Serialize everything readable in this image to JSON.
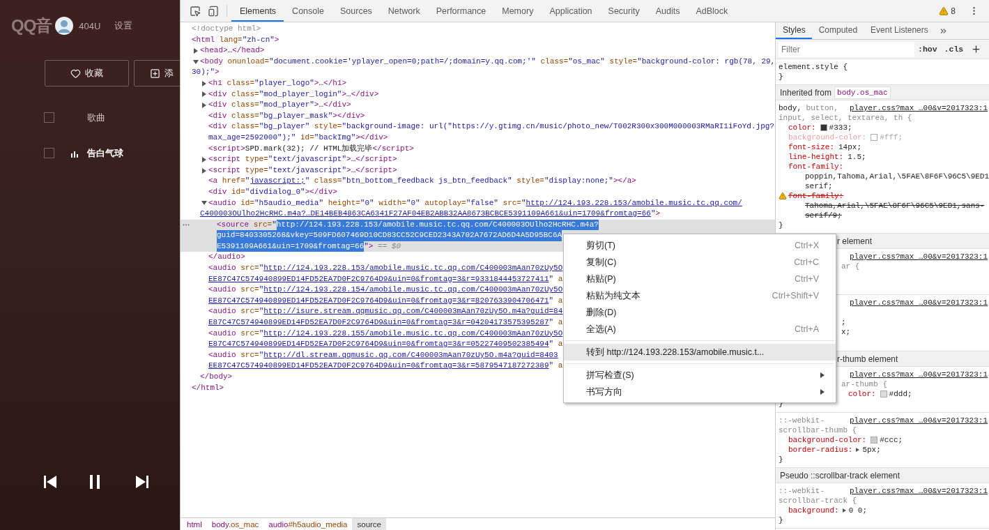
{
  "player": {
    "logo": "QQ音",
    "user": "404U",
    "settings": "设置",
    "buttons": [
      {
        "kind": "favorite",
        "label": "收藏"
      },
      {
        "kind": "add",
        "label": "添"
      }
    ],
    "songs": [
      {
        "title": "歌曲",
        "checked": false,
        "playing": false
      },
      {
        "title": "告白气球",
        "checked": false,
        "playing": true
      }
    ]
  },
  "devtools": {
    "tabs": [
      {
        "label": "Elements",
        "selected": true
      },
      {
        "label": "Console",
        "selected": false
      },
      {
        "label": "Sources",
        "selected": false
      },
      {
        "label": "Network",
        "selected": false
      },
      {
        "label": "Performance",
        "selected": false
      },
      {
        "label": "Memory",
        "selected": false
      },
      {
        "label": "Application",
        "selected": false
      },
      {
        "label": "Security",
        "selected": false
      },
      {
        "label": "Audits",
        "selected": false
      },
      {
        "label": "AdBlock",
        "selected": false
      }
    ],
    "warnings": "8",
    "tree": [
      {
        "kind": "plain",
        "selected": false,
        "lines": [
          [
            {
              "doctype": "<!doctype html>"
            }
          ]
        ]
      },
      {
        "kind": "plain",
        "selected": false,
        "lines": [
          [
            {
              "tag": "<html"
            },
            {
              "attr": " lang="
            },
            {
              "value": "\"zh-cn\""
            },
            {
              "tag": ">"
            }
          ]
        ],
        "close": [
          {
            "tag": "</html>"
          }
        ],
        "children": [
          {
            "kind": "expandable",
            "expanded": false,
            "selected": false,
            "lines": [
              [
                {
                  "tag": "<head>"
                },
                {
                  "text": "…"
                },
                {
                  "tag": "</head>"
                }
              ]
            ]
          },
          {
            "kind": "expandable",
            "expanded": true,
            "selected": false,
            "lines": [
              [
                {
                  "tag": "<body"
                },
                {
                  "attr": " onunload="
                },
                {
                  "value": "\"document.cookie='yplayer_open=0;path=/;domain=y.qq.com;'\""
                },
                {
                  "attr": " class="
                },
                {
                  "value": "\"os_mac\""
                },
                {
                  "attr": " style="
                },
                {
                  "value": "\"background-color: rgb(78, 29,"
                }
              ],
              [
                {
                  "value": "30);\""
                },
                {
                  "tag": ">"
                }
              ]
            ],
            "close": [
              {
                "tag": "</body>"
              }
            ],
            "children": [
              {
                "kind": "expandable",
                "expanded": false,
                "selected": false,
                "lines": [
                  [
                    {
                      "tag": "<h1"
                    },
                    {
                      "attr": " class="
                    },
                    {
                      "value": "\"player_logo\""
                    },
                    {
                      "tag": ">"
                    },
                    {
                      "text": "…"
                    },
                    {
                      "tag": "</h1>"
                    }
                  ]
                ]
              },
              {
                "kind": "expandable",
                "expanded": false,
                "selected": false,
                "lines": [
                  [
                    {
                      "tag": "<div"
                    },
                    {
                      "attr": " class="
                    },
                    {
                      "value": "\"mod_player_login\""
                    },
                    {
                      "tag": ">"
                    },
                    {
                      "text": "…"
                    },
                    {
                      "tag": "</div>"
                    }
                  ]
                ]
              },
              {
                "kind": "expandable",
                "expanded": false,
                "selected": false,
                "lines": [
                  [
                    {
                      "tag": "<div"
                    },
                    {
                      "attr": " class="
                    },
                    {
                      "value": "\"mod_player\""
                    },
                    {
                      "tag": ">"
                    },
                    {
                      "text": "…"
                    },
                    {
                      "tag": "</div>"
                    }
                  ]
                ]
              },
              {
                "kind": "plain",
                "selected": false,
                "lines": [
                  [
                    {
                      "tag": "<div"
                    },
                    {
                      "attr": " class="
                    },
                    {
                      "value": "\"bg_player_mask\""
                    },
                    {
                      "tag": "></div>"
                    }
                  ]
                ]
              },
              {
                "kind": "plain",
                "selected": false,
                "lines": [
                  [
                    {
                      "tag": "<div"
                    },
                    {
                      "attr": " class="
                    },
                    {
                      "value": "\"bg_player\""
                    },
                    {
                      "attr": " style="
                    },
                    {
                      "value": "\"background-image: url(\"https://y.gtimg.cn/music/photo_new/T002R300x300M000003RMaRI1iFoYd.jpg?"
                    }
                  ],
                  [
                    {
                      "value": "max_age=2592000\");\""
                    },
                    {
                      "attr": " id="
                    },
                    {
                      "value": "\"backImg\""
                    },
                    {
                      "tag": "></div>"
                    }
                  ]
                ]
              },
              {
                "kind": "plain",
                "selected": false,
                "lines": [
                  [
                    {
                      "tag": "<script>"
                    },
                    {
                      "text": "SPD.mark(32); // HTML加载完毕"
                    },
                    {
                      "tag": "</script>"
                    }
                  ]
                ]
              },
              {
                "kind": "expandable",
                "expanded": false,
                "selected": false,
                "lines": [
                  [
                    {
                      "tag": "<script"
                    },
                    {
                      "attr": " type="
                    },
                    {
                      "value": "\"text/javascript\""
                    },
                    {
                      "tag": ">"
                    },
                    {
                      "text": "…"
                    },
                    {
                      "tag": "</script>"
                    }
                  ]
                ]
              },
              {
                "kind": "expandable",
                "expanded": false,
                "selected": false,
                "lines": [
                  [
                    {
                      "tag": "<script"
                    },
                    {
                      "attr": " type="
                    },
                    {
                      "value": "\"text/javascript\""
                    },
                    {
                      "tag": ">"
                    },
                    {
                      "text": "…"
                    },
                    {
                      "tag": "</script>"
                    }
                  ]
                ]
              },
              {
                "kind": "plain",
                "selected": false,
                "lines": [
                  [
                    {
                      "tag": "<a"
                    },
                    {
                      "attr": " href="
                    },
                    {
                      "value": "\""
                    },
                    {
                      "link": "javascript:;"
                    },
                    {
                      "value": "\""
                    },
                    {
                      "attr": " class="
                    },
                    {
                      "value": "\"btn_bottom_feedback js_btn_feedback\""
                    },
                    {
                      "attr": " style="
                    },
                    {
                      "value": "\"display:none;\""
                    },
                    {
                      "tag": "></a>"
                    }
                  ]
                ]
              },
              {
                "kind": "plain",
                "selected": false,
                "lines": [
                  [
                    {
                      "tag": "<div"
                    },
                    {
                      "attr": " id="
                    },
                    {
                      "value": "\"divdialog_0\""
                    },
                    {
                      "tag": "></div>"
                    }
                  ]
                ]
              },
              {
                "kind": "expandable",
                "expanded": true,
                "selected": false,
                "lines": [
                  [
                    {
                      "tag": "<audio"
                    },
                    {
                      "attr": " id="
                    },
                    {
                      "value": "\"h5audio_media\""
                    },
                    {
                      "attr": " height="
                    },
                    {
                      "value": "\"0\""
                    },
                    {
                      "attr": " width="
                    },
                    {
                      "value": "\"0\""
                    },
                    {
                      "attr": " autoplay="
                    },
                    {
                      "value": "\"false\""
                    },
                    {
                      "attr": " src="
                    },
                    {
                      "value": "\""
                    },
                    {
                      "link": "http://124.193.228.153/amobile.music.tc.qq.com/"
                    }
                  ],
                  [
                    {
                      "link": "C400003OUlho2HcRHC.m4a?…DE14BEB4863CA6341F27AF04EB2ABB32AA8673BCBCE5391109A661&uin=1709&fromtag=66"
                    },
                    {
                      "value": "\""
                    },
                    {
                      "tag": ">"
                    }
                  ]
                ],
                "close": [
                  {
                    "tag": "</audio>"
                  }
                ],
                "children": [
                  {
                    "kind": "plain",
                    "selected": true,
                    "lines": [
                      [
                        {
                          "tag": "<source"
                        },
                        {
                          "attr": " src="
                        },
                        {
                          "value": "\""
                        },
                        {
                          "selection": "http://124.193.228.153/amobile.music.tc.qq.com/C400003OUlho2HcRHC.m4a?"
                        }
                      ],
                      [
                        {
                          "selection": "guid=8403305268&vkey=509FD607469D10CD83CC52C9CED2343A702A7672AD6D4A5D95BC6A"
                        }
                      ],
                      [
                        {
                          "selection": "E5391109A661&uin=1709&fromtag=66"
                        },
                        {
                          "value": "\""
                        },
                        {
                          "tag": ">"
                        },
                        {
                          "hint": " == $0"
                        }
                      ]
                    ]
                  }
                ]
              },
              {
                "kind": "plain",
                "selected": false,
                "lines": [
                  [
                    {
                      "tag": "<audio"
                    },
                    {
                      "attr": " src="
                    },
                    {
                      "value": "\""
                    },
                    {
                      "link": "http://124.193.228.153/amobile.music.tc.qq.com/C400003mAan70zUy5O"
                    }
                  ],
                  [
                    {
                      "link": "EE87C47C574940899ED14FD52EA7D0F2C9764D9&uin=0&fromtag=3&r=9331844453727411"
                    },
                    {
                      "value": "\""
                    },
                    {
                      "attr": " a"
                    }
                  ]
                ]
              },
              {
                "kind": "plain",
                "selected": false,
                "lines": [
                  [
                    {
                      "tag": "<audio"
                    },
                    {
                      "attr": " src="
                    },
                    {
                      "value": "\""
                    },
                    {
                      "link": "http://124.193.228.154/amobile.music.tc.qq.com/C400003mAan70zUy5O"
                    }
                  ],
                  [
                    {
                      "link": "EE87C47C574940899ED14FD52EA7D0F2C9764D9&uin=0&fromtag=3&r=8207633904706471"
                    },
                    {
                      "value": "\""
                    },
                    {
                      "attr": " a"
                    }
                  ]
                ]
              },
              {
                "kind": "plain",
                "selected": false,
                "lines": [
                  [
                    {
                      "tag": "<audio"
                    },
                    {
                      "attr": " src="
                    },
                    {
                      "value": "\""
                    },
                    {
                      "link": "http://isure.stream.qqmusic.qq.com/C400003mAan70zUy5O.m4a?guid=84"
                    }
                  ],
                  [
                    {
                      "link": "E87C47C574940899ED14FD52EA7D0F2C9764D9&uin=0&fromtag=3&r=04204173575395287"
                    },
                    {
                      "value": "\""
                    },
                    {
                      "attr": " a"
                    }
                  ]
                ]
              },
              {
                "kind": "plain",
                "selected": false,
                "lines": [
                  [
                    {
                      "tag": "<audio"
                    },
                    {
                      "attr": " src="
                    },
                    {
                      "value": "\""
                    },
                    {
                      "link": "http://124.193.228.155/amobile.music.tc.qq.com/C400003mAan70zUy5O"
                    }
                  ],
                  [
                    {
                      "link": "E87C47C574940899ED14FD52EA7D0F2C9764D9&uin=0&fromtag=3&r=05227409502385494"
                    },
                    {
                      "value": "\""
                    },
                    {
                      "attr": " a"
                    }
                  ]
                ]
              },
              {
                "kind": "plain",
                "selected": false,
                "lines": [
                  [
                    {
                      "tag": "<audio"
                    },
                    {
                      "attr": " src="
                    },
                    {
                      "value": "\""
                    },
                    {
                      "link": "http://dl.stream.qqmusic.qq.com/C400003mAan70zUy5O.m4a?guid=8403"
                    }
                  ],
                  [
                    {
                      "link": "EE87C47C574940899ED14FD52EA7D0F2C9764D9&uin=0&fromtag=3&r=5879547187272389"
                    },
                    {
                      "value": "\""
                    },
                    {
                      "attr": " a"
                    }
                  ]
                ]
              }
            ]
          }
        ]
      }
    ],
    "breadcrumbs": [
      {
        "tag": "html",
        "selected": false
      },
      {
        "tag": "body",
        "detail": ".os_mac",
        "selected": false
      },
      {
        "tag": "audio",
        "detail": "#h5audio_media",
        "selected": false
      },
      {
        "tag": "source",
        "selected": true
      }
    ],
    "sidebar": {
      "tabs": [
        {
          "label": "Styles",
          "selected": true
        },
        {
          "label": "Computed",
          "selected": false
        },
        {
          "label": "Event Listeners",
          "selected": false
        }
      ],
      "filter": {
        "placeholder": "Filter"
      },
      "hov": ":hov",
      "cls": ".cls",
      "sections": [
        {
          "kind": "rule",
          "covered": false,
          "lines": [
            {
              "kind": "selector",
              "tokens": [
                {
                  "matched": "element.style {"
                }
              ]
            },
            {
              "kind": "close",
              "text": "}"
            }
          ]
        },
        {
          "kind": "header",
          "covered": false,
          "label": "Inherited from",
          "badge": "body.os_mac"
        },
        {
          "kind": "rule",
          "covered": false,
          "source": "player.css?max …00&v=2017323:1",
          "lines": [
            {
              "kind": "selector",
              "tokens": [
                {
                  "matched": "body,"
                },
                {
                  "unmatched": " button,"
                }
              ]
            },
            {
              "kind": "selector",
              "tokens": [
                {
                  "unmatched": "input, select, textarea, th {"
                }
              ]
            },
            {
              "kind": "decl",
              "prop": "color:",
              "color": "#333333",
              "value": "#333;",
              "inactive": false,
              "struck": false,
              "warning": false,
              "expander": false
            },
            {
              "kind": "decl",
              "prop": "background-color:",
              "color": "#ffffff",
              "value": "#fff;",
              "inactive": true,
              "struck": false,
              "warning": false,
              "expander": false
            },
            {
              "kind": "decl",
              "prop": "font-size:",
              "value": "14px;",
              "inactive": false,
              "struck": false,
              "warning": false,
              "expander": false
            },
            {
              "kind": "decl",
              "prop": "line-height:",
              "value": "1.5;",
              "inactive": false,
              "struck": false,
              "warning": false,
              "expander": false
            },
            {
              "kind": "decl",
              "prop": "font-family:",
              "inactive": false,
              "struck": false,
              "warning": false,
              "expander": false
            },
            {
              "kind": "cont",
              "text": "poppin,Tahoma,Arial,\\5FAE\\8F6F\\96C5\\9ED1",
              "struck": false
            },
            {
              "kind": "cont",
              "text": "serif;",
              "struck": false
            },
            {
              "kind": "decl",
              "prop": "font-family:",
              "inactive": false,
              "struck": true,
              "warning": true,
              "expander": false
            },
            {
              "kind": "cont",
              "text": "Tahoma,Arial,\\5FAE\\8F6F\\96C5\\9ED1,sans-",
              "struck": true
            },
            {
              "kind": "cont",
              "text": "serif/9;",
              "struck": true
            },
            {
              "kind": "close",
              "text": "}"
            }
          ]
        },
        {
          "kind": "header",
          "covered": true,
          "label": "r element"
        },
        {
          "kind": "rule",
          "covered": true,
          "source": "player.css?max …00&v=2017323:1",
          "lines": [
            {
              "kind": "frag_selector",
              "text": "ar {"
            }
          ]
        },
        {
          "kind": "rule",
          "covered": true,
          "source": "player.css?max …00&v=2017323:1",
          "lines": [
            {
              "kind": "frag_value",
              "text": ";"
            },
            {
              "kind": "frag_value",
              "text": "x;"
            }
          ]
        },
        {
          "kind": "header",
          "covered": true,
          "label": "r-thumb element"
        },
        {
          "kind": "rule",
          "covered": true,
          "source": "player.css?max …00&v=2017323:1",
          "lines": [
            {
              "kind": "frag_selector",
              "text": "ar-thumb {"
            },
            {
              "kind": "decl",
              "prop": "color:",
              "color": "#dddddd",
              "value": "#ddd;",
              "inactive": false,
              "struck": false,
              "warning": false,
              "expander": false
            },
            {
              "kind": "close",
              "text": "}"
            }
          ]
        },
        {
          "kind": "rule",
          "covered": false,
          "source": "player.css?max …00&v=2017323:1",
          "lines": [
            {
              "kind": "selector",
              "tokens": [
                {
                  "unmatched": "::-webkit-"
                }
              ]
            },
            {
              "kind": "selector",
              "tokens": [
                {
                  "unmatched": "scrollbar-thumb {"
                }
              ]
            },
            {
              "kind": "decl",
              "prop": "background-color:",
              "color": "#cccccc",
              "value": "#ccc;",
              "inactive": false,
              "struck": false,
              "warning": false,
              "expander": false
            },
            {
              "kind": "decl",
              "prop": "border-radius:",
              "value": "5px;",
              "inactive": false,
              "struck": false,
              "warning": false,
              "expander": true
            },
            {
              "kind": "close",
              "text": "}"
            }
          ]
        },
        {
          "kind": "header",
          "covered": false,
          "label": "Pseudo ::scrollbar-track element"
        },
        {
          "kind": "rule",
          "covered": false,
          "source": "player.css?max …00&v=2017323:1",
          "lines": [
            {
              "kind": "selector",
              "tokens": [
                {
                  "unmatched": "::-webkit-"
                }
              ]
            },
            {
              "kind": "selector",
              "tokens": [
                {
                  "unmatched": "scrollbar-track {"
                }
              ]
            },
            {
              "kind": "decl",
              "prop": "background:",
              "value": "0 0;",
              "inactive": false,
              "struck": false,
              "warning": false,
              "expander": true
            },
            {
              "kind": "close",
              "text": "}"
            }
          ]
        }
      ]
    },
    "context_menu": [
      {
        "kind": "item",
        "label": "剪切(T)",
        "shortcut": "Ctrl+X",
        "selected": false
      },
      {
        "kind": "item",
        "label": "复制(C)",
        "shortcut": "Ctrl+C",
        "selected": false
      },
      {
        "kind": "item",
        "label": "粘贴(P)",
        "shortcut": "Ctrl+V",
        "selected": false
      },
      {
        "kind": "item",
        "label": "粘贴为纯文本",
        "shortcut": "Ctrl+Shift+V",
        "selected": false
      },
      {
        "kind": "item",
        "label": "删除(D)",
        "selected": false
      },
      {
        "kind": "item",
        "label": "全选(A)",
        "shortcut": "Ctrl+A",
        "selected": false
      },
      {
        "kind": "separator"
      },
      {
        "kind": "item",
        "label": "转到 http://124.193.228.153/amobile.music.t...",
        "selected": true
      },
      {
        "kind": "separator"
      },
      {
        "kind": "submenu",
        "label": "拼写检查(S)",
        "selected": false
      },
      {
        "kind": "submenu",
        "label": "书写方向",
        "selected": false
      }
    ]
  }
}
